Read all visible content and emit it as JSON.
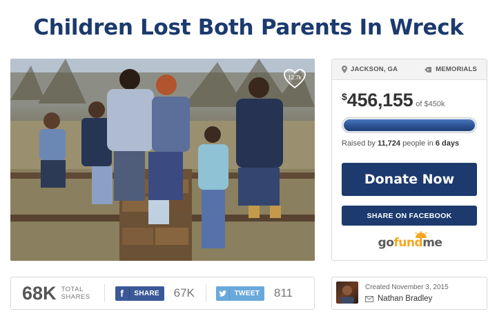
{
  "page": {
    "title": "Children Lost Both Parents In Wreck"
  },
  "photo": {
    "heart_count": "12.7k",
    "heart_icon": "heart-icon"
  },
  "campaign": {
    "location": "JACKSON, GA",
    "category": "MEMORIALS",
    "currency_symbol": "$",
    "amount": "456,155",
    "goal": "of $450k",
    "progress_fraction": 1.0,
    "raised_prefix": "Raised by",
    "people_count": "11,724",
    "people_suffix": "people in",
    "days": "6 days",
    "donate_label": "Donate Now",
    "facebook_label": "SHARE ON FACEBOOK",
    "logo": {
      "go": "go",
      "fund": "fund",
      "me": "me"
    },
    "colors": {
      "brand_navy": "#1c3a6e",
      "logo_orange": "#f5a623",
      "facebook_blue": "#3b5998",
      "twitter_blue": "#6aa9dc"
    }
  },
  "sharebar": {
    "total_shares": "68K",
    "total_label_1": "TOTAL",
    "total_label_2": "SHARES",
    "fb_label": "SHARE",
    "fb_count": "67K",
    "tw_label": "TWEET",
    "tw_count": "811"
  },
  "organizer": {
    "created": "Created November 3, 2015",
    "name": "Nathan Bradley"
  }
}
